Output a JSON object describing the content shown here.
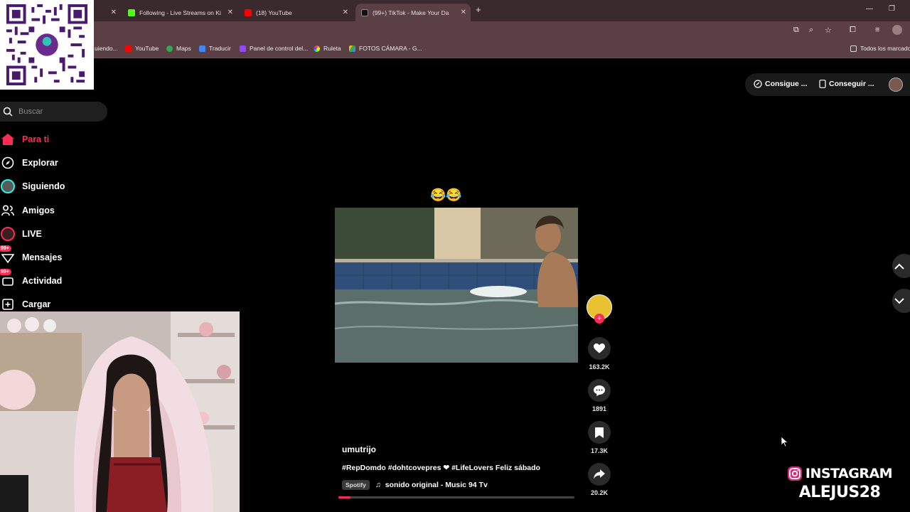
{
  "browser": {
    "tabs": [
      {
        "title": "Following - Live Streams on Ki",
        "active": false
      },
      {
        "title": "(18) YouTube",
        "active": false
      },
      {
        "title": "(99+) TikTok - Make Your Da",
        "active": true
      }
    ],
    "new_tab_icon": "plus-icon",
    "bookmarks": [
      {
        "label": "uiendo...",
        "icon": "bookmark-icon"
      },
      {
        "label": "YouTube",
        "icon": "youtube-icon"
      },
      {
        "label": "Maps",
        "icon": "maps-icon"
      },
      {
        "label": "Traducir",
        "icon": "translate-icon"
      },
      {
        "label": "Panel de control del...",
        "icon": "panel-icon"
      },
      {
        "label": "Ruleta",
        "icon": "ruleta-icon"
      },
      {
        "label": "FOTOS CÁMARA - G...",
        "icon": "drive-icon"
      }
    ],
    "all_bookmarks": "Todos los marcado"
  },
  "sidebar": {
    "search_placeholder": "Buscar",
    "items": [
      {
        "label": "Para ti",
        "icon": "home-icon",
        "active": true
      },
      {
        "label": "Explorar",
        "icon": "compass-icon"
      },
      {
        "label": "Siguiendo",
        "icon": "following-avatar-icon"
      },
      {
        "label": "Amigos",
        "icon": "friends-icon"
      },
      {
        "label": "LIVE",
        "icon": "live-icon"
      },
      {
        "label": "Mensajes",
        "icon": "messages-icon",
        "badge": "99+"
      },
      {
        "label": "Actividad",
        "icon": "activity-icon",
        "badge": "99+"
      },
      {
        "label": "Cargar",
        "icon": "upload-icon"
      }
    ]
  },
  "topbar": {
    "coins_label": "Consigue ...",
    "app_label": "Conseguir ..."
  },
  "video": {
    "emoji_caption": "😂😂",
    "author": "umutrijo",
    "caption": "#RepDomdo #dohtcovepres ❤ #LifeLovers Feliz sábado",
    "spotify_label": "Spotify",
    "music": "sonido original - Music 94 Tv",
    "progress": 0.05,
    "likes": "163.2K",
    "comments": "1891",
    "saves": "17.3K",
    "shares": "20.2K"
  },
  "overlay": {
    "instagram_line1": "INSTAGRAM",
    "instagram_line2": "ALEJUS28"
  },
  "colors": {
    "accent": "#fe2c55",
    "chrome": "#5a3f45"
  }
}
